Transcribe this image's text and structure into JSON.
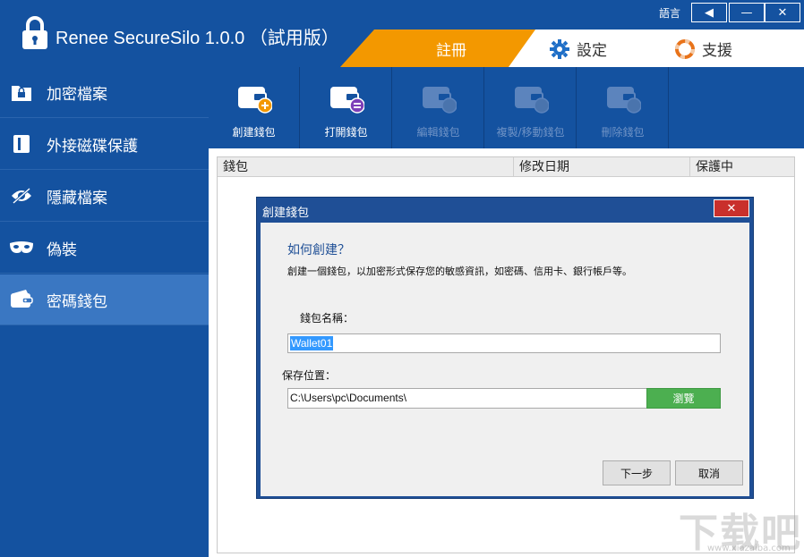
{
  "app": {
    "title": "Renee SecureSilo 1.0.0 （試用版）",
    "language_label": "語言"
  },
  "window_controls": {
    "back": "◀",
    "minimize": "—",
    "close": "✕"
  },
  "top_tabs": {
    "register": "註冊",
    "settings": "設定",
    "support": "支援"
  },
  "sidebar": {
    "items": [
      {
        "label": "加密檔案",
        "icon": "lock-folder-icon"
      },
      {
        "label": "外接磁碟保護",
        "icon": "usb-drive-icon"
      },
      {
        "label": "隱藏檔案",
        "icon": "eye-slash-icon"
      },
      {
        "label": "偽裝",
        "icon": "mask-icon"
      },
      {
        "label": "密碼錢包",
        "icon": "wallet-icon"
      }
    ],
    "active_index": 4
  },
  "toolbar": {
    "create": "創建錢包",
    "open": "打開錢包",
    "edit": "編輯錢包",
    "copy_move": "複製/移動錢包",
    "delete": "刪除錢包"
  },
  "list": {
    "columns": [
      "錢包",
      "修改日期",
      "保護中"
    ]
  },
  "dialog": {
    "title": "創建錢包",
    "close": "✕",
    "heading": "如何創建？",
    "description": "創建一個錢包，以加密形式保存您的敏感資訊，如密碼、信用卡、銀行帳戶等。",
    "name_label": "錢包名稱：",
    "name_value": "Wallet01",
    "location_label": "保存位置：",
    "location_value": "C:\\Users\\pc\\Documents\\",
    "browse": "瀏覽",
    "next": "下一步",
    "cancel": "取消"
  },
  "watermark": {
    "text": "下载吧",
    "url": "www.xiazaiba.com"
  },
  "colors": {
    "primary": "#1452a0",
    "accent": "#f39800",
    "sidebar_active": "#3a77c2",
    "browse_green": "#4caf50",
    "close_red": "#c9302c"
  }
}
